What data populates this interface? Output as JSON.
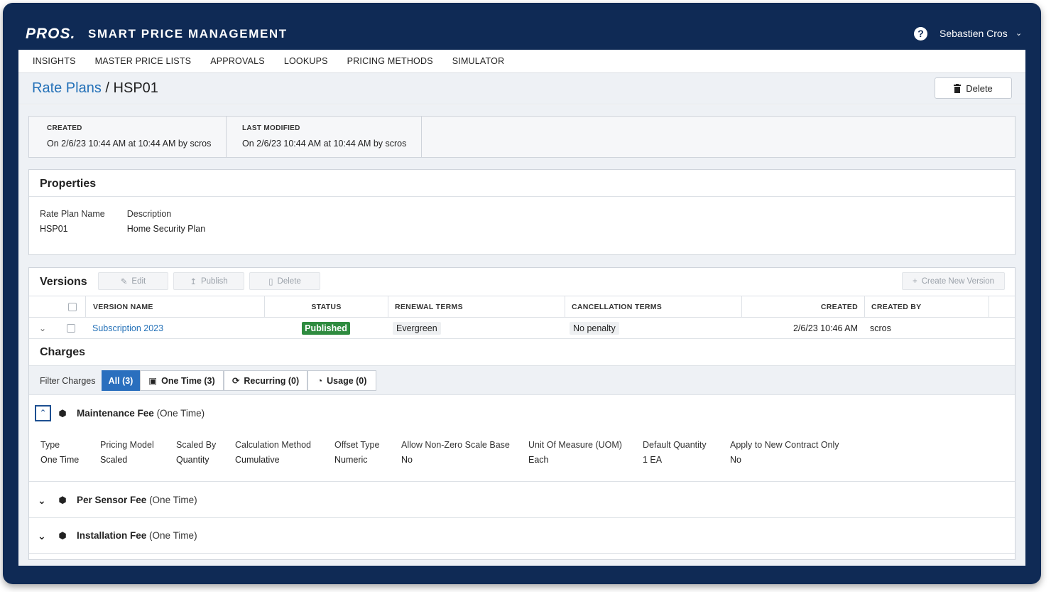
{
  "brand": {
    "logo": "PROS.",
    "app_title": "SMART PRICE MANAGEMENT"
  },
  "user": {
    "name": "Sebastien Cros",
    "help_icon": "?"
  },
  "nav": {
    "items": [
      "INSIGHTS",
      "MASTER PRICE LISTS",
      "APPROVALS",
      "LOOKUPS",
      "PRICING METHODS",
      "SIMULATOR"
    ]
  },
  "header": {
    "breadcrumb_link": "Rate Plans",
    "separator": "/",
    "current": "HSP01",
    "delete_label": "Delete"
  },
  "meta": {
    "created_label": "CREATED",
    "created_value": "On 2/6/23 10:44 AM at 10:44 AM by scros",
    "modified_label": "LAST MODIFIED",
    "modified_value": "On 2/6/23 10:44 AM at 10:44 AM by scros"
  },
  "properties": {
    "title": "Properties",
    "fields": [
      {
        "label": "Rate Plan Name",
        "value": "HSP01"
      },
      {
        "label": "Description",
        "value": "Home Security Plan"
      }
    ]
  },
  "versions": {
    "title": "Versions",
    "buttons": {
      "edit": "Edit",
      "publish": "Publish",
      "delete": "Delete",
      "create": "Create New Version"
    },
    "columns": [
      "VERSION NAME",
      "STATUS",
      "RENEWAL TERMS",
      "CANCELLATION TERMS",
      "CREATED",
      "CREATED BY"
    ],
    "rows": [
      {
        "name": "Subscription 2023",
        "status": "Published",
        "renewal": "Evergreen",
        "cancellation": "No penalty",
        "created": "2/6/23 10:46 AM",
        "created_by": "scros"
      }
    ]
  },
  "charges": {
    "title": "Charges",
    "filter_label": "Filter Charges",
    "filters": [
      {
        "label": "All (3)",
        "active": true
      },
      {
        "label": "One Time (3)",
        "active": false
      },
      {
        "label": "Recurring (0)",
        "active": false
      },
      {
        "label": "Usage (0)",
        "active": false
      }
    ],
    "items": [
      {
        "name": "Maintenance Fee",
        "suffix": "(One Time)",
        "expanded": true,
        "attributes": [
          {
            "label": "Type",
            "value": "One Time"
          },
          {
            "label": "Pricing Model",
            "value": "Scaled"
          },
          {
            "label": "Scaled By",
            "value": "Quantity"
          },
          {
            "label": "Calculation Method",
            "value": "Cumulative"
          },
          {
            "label": "Offset Type",
            "value": "Numeric"
          },
          {
            "label": "Allow Non-Zero Scale Base",
            "value": "No"
          },
          {
            "label": "Unit Of Measure (UOM)",
            "value": "Each"
          },
          {
            "label": "Default Quantity",
            "value": "1 EA"
          },
          {
            "label": "Apply to New Contract Only",
            "value": "No"
          }
        ]
      },
      {
        "name": "Per Sensor Fee",
        "suffix": "(One Time)",
        "expanded": false
      },
      {
        "name": "Installation Fee",
        "suffix": "(One Time)",
        "expanded": false
      }
    ]
  },
  "colors": {
    "navy": "#0f2a55",
    "link": "#2471b8",
    "published": "#2e8b3f",
    "active_filter": "#2a6fbe"
  }
}
